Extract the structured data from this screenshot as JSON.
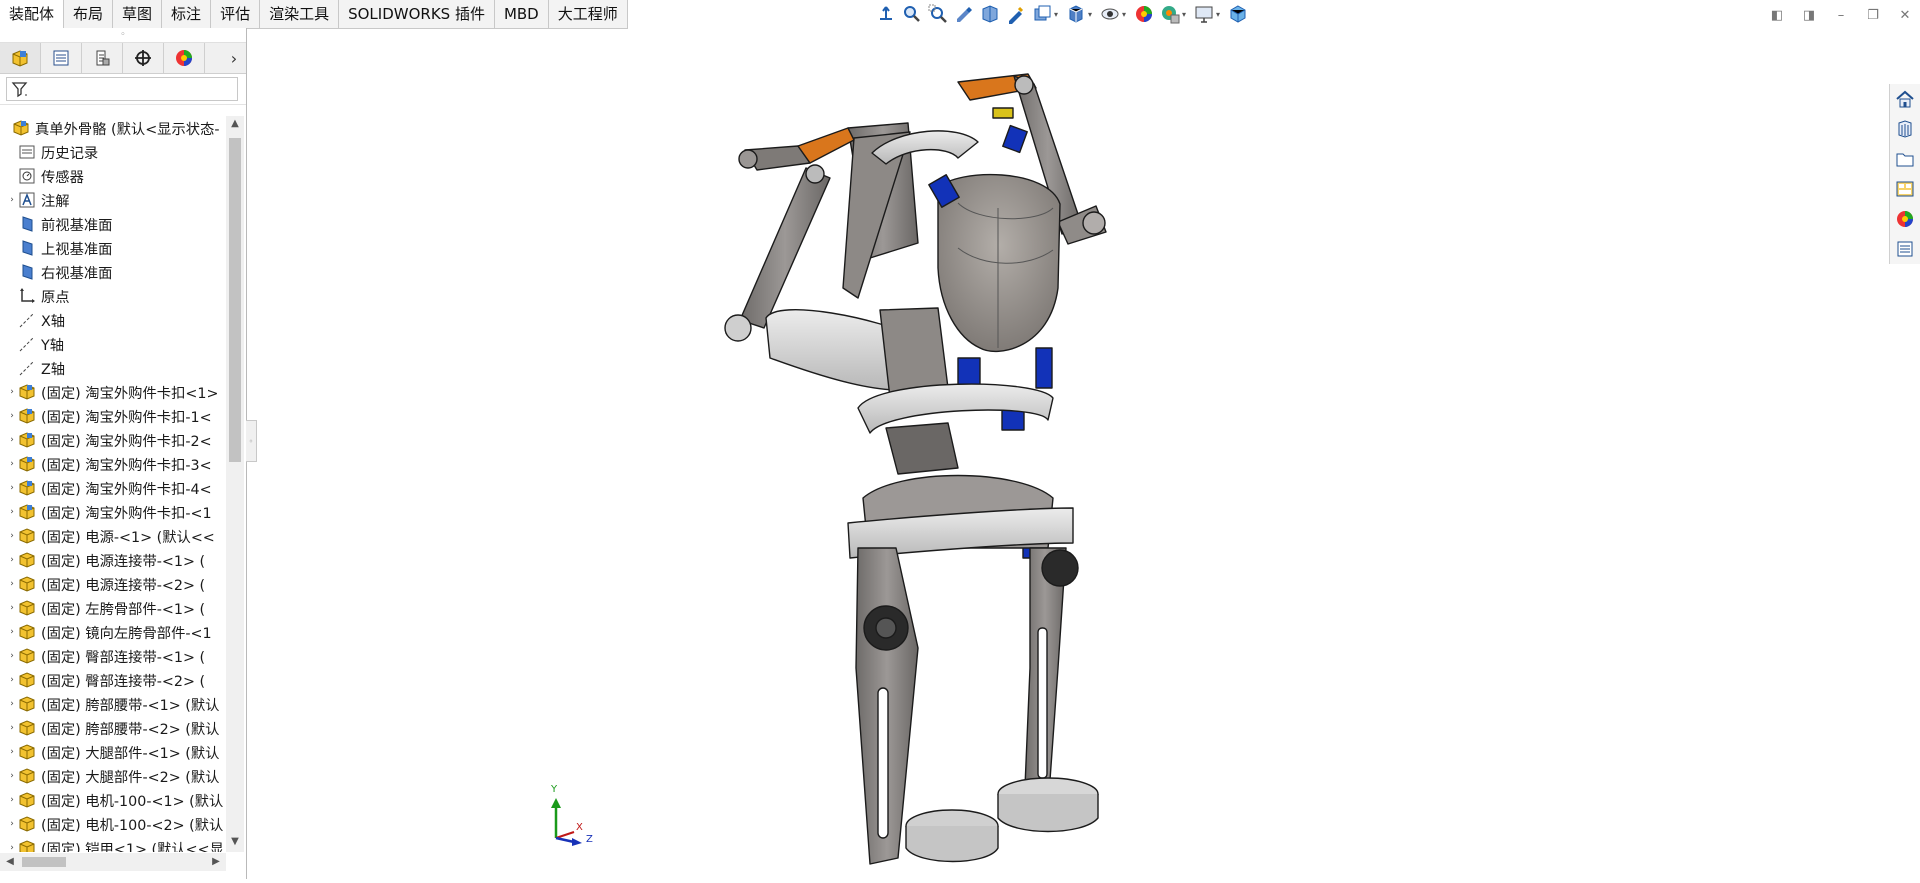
{
  "command_tabs": [
    "装配体",
    "布局",
    "草图",
    "标注",
    "评估",
    "渲染工具",
    "SOLIDWORKS 插件",
    "MBD",
    "大工程师"
  ],
  "active_tab": "装配体",
  "tree": {
    "root": "真单外骨骼 (默认<显示状态-",
    "items": [
      {
        "label": "历史记录",
        "icon": "history-icon",
        "expand": false
      },
      {
        "label": "传感器",
        "icon": "sensor-icon",
        "expand": false
      },
      {
        "label": "注解",
        "icon": "annotation-icon",
        "expand": true
      },
      {
        "label": "前视基准面",
        "icon": "plane-icon",
        "expand": false
      },
      {
        "label": "上视基准面",
        "icon": "plane-icon",
        "expand": false
      },
      {
        "label": "右视基准面",
        "icon": "plane-icon",
        "expand": false
      },
      {
        "label": "原点",
        "icon": "origin-icon",
        "expand": false
      },
      {
        "label": "X轴",
        "icon": "axis-icon",
        "expand": false
      },
      {
        "label": "Y轴",
        "icon": "axis-icon",
        "expand": false
      },
      {
        "label": "Z轴",
        "icon": "axis-icon",
        "expand": false
      },
      {
        "label": "(固定) 淘宝外购件卡扣<1>",
        "icon": "subassembly-icon",
        "expand": true
      },
      {
        "label": "(固定) 淘宝外购件卡扣-1<",
        "icon": "subassembly-icon",
        "expand": true
      },
      {
        "label": "(固定) 淘宝外购件卡扣-2<",
        "icon": "subassembly-icon",
        "expand": true
      },
      {
        "label": "(固定) 淘宝外购件卡扣-3<",
        "icon": "subassembly-icon",
        "expand": true
      },
      {
        "label": "(固定) 淘宝外购件卡扣-4<",
        "icon": "subassembly-icon",
        "expand": true
      },
      {
        "label": "(固定) 淘宝外购件卡扣-<1",
        "icon": "subassembly-icon",
        "expand": true
      },
      {
        "label": "(固定) 电源-<1> (默认<<",
        "icon": "part-icon",
        "expand": true
      },
      {
        "label": "(固定) 电源连接带-<1> (",
        "icon": "part-icon",
        "expand": true
      },
      {
        "label": "(固定) 电源连接带-<2> (",
        "icon": "part-icon",
        "expand": true
      },
      {
        "label": "(固定) 左胯骨部件-<1> (",
        "icon": "part-icon",
        "expand": true
      },
      {
        "label": "(固定) 镜向左胯骨部件-<1",
        "icon": "part-icon",
        "expand": true
      },
      {
        "label": "(固定) 臀部连接带-<1> (",
        "icon": "part-icon",
        "expand": true
      },
      {
        "label": "(固定) 臀部连接带-<2> (",
        "icon": "part-icon",
        "expand": true
      },
      {
        "label": "(固定) 胯部腰带-<1> (默认",
        "icon": "part-icon",
        "expand": true
      },
      {
        "label": "(固定) 胯部腰带-<2> (默认",
        "icon": "part-icon",
        "expand": true
      },
      {
        "label": "(固定) 大腿部件-<1> (默认",
        "icon": "part-icon",
        "expand": true
      },
      {
        "label": "(固定) 大腿部件-<2> (默认",
        "icon": "part-icon",
        "expand": true
      },
      {
        "label": "(固定) 电机-100-<1> (默认",
        "icon": "part-icon",
        "expand": true
      },
      {
        "label": "(固定) 电机-100-<2> (默认",
        "icon": "part-icon",
        "expand": true
      },
      {
        "label": "(固定) 铠甲<1> (默认<<显",
        "icon": "part-icon",
        "expand": true
      }
    ]
  },
  "panel_tabs": [
    "feature-manager-icon",
    "property-manager-icon",
    "configuration-manager-icon",
    "dimxpert-icon",
    "display-manager-icon"
  ],
  "hud_icons": [
    "view-orientation-icon",
    "zoom-to-fit-icon",
    "zoom-to-area-icon",
    "previous-view-icon",
    "section-view-icon",
    "dynamic-annotation-icon",
    "view-type-icon",
    "display-style-icon",
    "hide-show-icon",
    "edit-appearance-icon",
    "apply-scene-icon",
    "view-settings-icon",
    "cube-icon"
  ],
  "taskpane_icons": [
    "home-icon",
    "design-library-icon",
    "file-explorer-icon",
    "view-palette-icon",
    "appearances-icon",
    "custom-properties-icon"
  ],
  "triad": {
    "y": "Y",
    "x": "X",
    "z": "Z"
  },
  "colors": {
    "accent": "#1f5fb0",
    "part_gray": "#8a8785",
    "strap_gray": "#cfcfcf",
    "buckle_blue": "#1232b8",
    "buckle_yellow": "#d9c21a",
    "orange": "#d9761c"
  }
}
